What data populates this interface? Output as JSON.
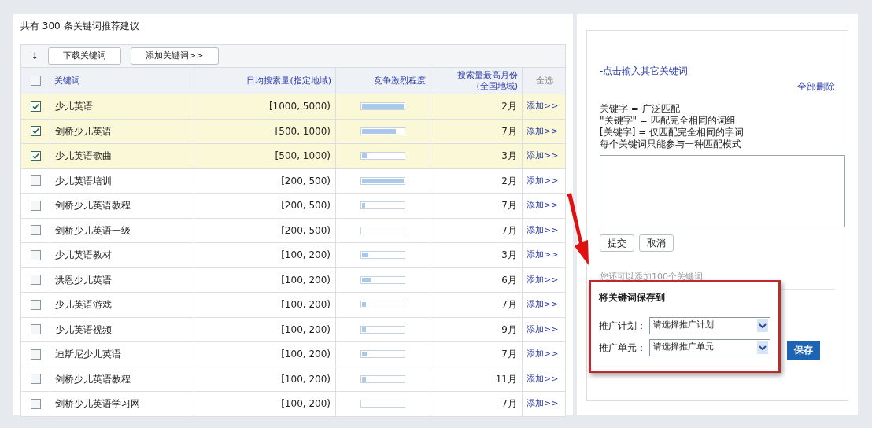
{
  "summary": "共有 300 条关键词推荐建议",
  "toolbar": {
    "sort_icon": "↓",
    "buttons": [
      "下载关键词",
      "添加关键词>>"
    ]
  },
  "table": {
    "select_all": {
      "checked": false
    },
    "columns": [
      "关键词",
      "日均搜索量(指定地域)",
      "竞争激烈程度",
      "搜索量最高月份\n(全国地域)",
      "全选"
    ],
    "rows": [
      {
        "checked": true,
        "keyword": "少儿英语",
        "volume": "[1000, 5000)",
        "level": 1.0,
        "month": "2月",
        "action": "添加>>"
      },
      {
        "checked": true,
        "keyword": "剑桥少儿英语",
        "volume": "[500, 1000)",
        "level": 0.82,
        "month": "7月",
        "action": "添加>>"
      },
      {
        "checked": true,
        "keyword": "少儿英语歌曲",
        "volume": "[500, 1000)",
        "level": 0.12,
        "month": "3月",
        "action": "添加>>"
      },
      {
        "checked": false,
        "keyword": "少儿英语培训",
        "volume": "[200, 500)",
        "level": 1.0,
        "month": "2月",
        "action": "添加>>"
      },
      {
        "checked": false,
        "keyword": "剑桥少儿英语教程",
        "volume": "[200, 500)",
        "level": 0.08,
        "month": "7月",
        "action": "添加>>"
      },
      {
        "checked": false,
        "keyword": "剑桥少儿英语一级",
        "volume": "[200, 500)",
        "level": 0.0,
        "month": "7月",
        "action": "添加>>"
      },
      {
        "checked": false,
        "keyword": "少儿英语教材",
        "volume": "[100, 200)",
        "level": 0.15,
        "month": "3月",
        "action": "添加>>"
      },
      {
        "checked": false,
        "keyword": "洪恩少儿英语",
        "volume": "[100, 200)",
        "level": 0.2,
        "month": "6月",
        "action": "添加>>"
      },
      {
        "checked": false,
        "keyword": "少儿英语游戏",
        "volume": "[100, 200)",
        "level": 0.1,
        "month": "7月",
        "action": "添加>>"
      },
      {
        "checked": false,
        "keyword": "少儿英语视频",
        "volume": "[100, 200)",
        "level": 0.1,
        "month": "9月",
        "action": "添加>>"
      },
      {
        "checked": false,
        "keyword": "迪斯尼少儿英语",
        "volume": "[100, 200)",
        "level": 0.12,
        "month": "7月",
        "action": "添加>>"
      },
      {
        "checked": false,
        "keyword": "剑桥少儿英语教程",
        "volume": "[100, 200)",
        "level": 0.1,
        "month": "11月",
        "action": "添加>>"
      },
      {
        "checked": false,
        "keyword": "剑桥少儿英语学习网",
        "volume": "[100, 200)",
        "level": 0.0,
        "month": "7月",
        "action": "添加>>"
      }
    ]
  },
  "side": {
    "input_link": "-点击输入其它关键词",
    "delete_all": "全部删除",
    "rules": [
      "关键字 = 广泛匹配",
      "\"关键字\" = 匹配完全相同的词组",
      "[关键字] = 仅匹配完全相同的字词",
      "每个关键词只能参与一种匹配模式"
    ],
    "buttons": [
      "提交",
      "取消"
    ],
    "remaining": "您还可以添加100个关键词",
    "save_box": {
      "title": "将关键词保存到",
      "fields": [
        {
          "label": "推广计划：",
          "value": "请选择推广计划"
        },
        {
          "label": "推广单元：",
          "value": "请选择推广单元"
        }
      ],
      "button": "保存"
    }
  }
}
